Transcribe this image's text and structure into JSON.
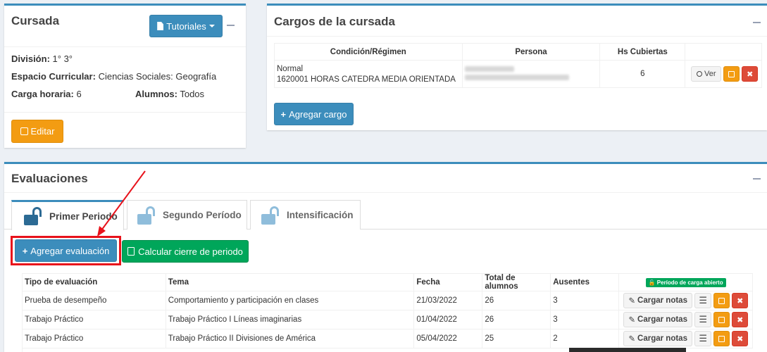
{
  "cursada": {
    "title": "Cursada",
    "tutorials_label": "Tutoriales",
    "division_label": "División:",
    "division_value": "1° 3°",
    "espacio_label": "Espacio Curricular:",
    "espacio_value": "Ciencias Sociales: Geografía",
    "carga_label": "Carga horaria:",
    "carga_value": "6",
    "alumnos_label": "Alumnos:",
    "alumnos_value": "Todos",
    "edit_label": "Editar"
  },
  "cargos": {
    "title": "Cargos de la cursada",
    "headers": [
      "Condición/Régimen",
      "Persona",
      "Hs Cubiertas"
    ],
    "row": {
      "condicion_line1": "Normal",
      "condicion_line2": "1620001 HORAS CATEDRA MEDIA ORIENTADA",
      "hs": "6",
      "ver_label": "Ver"
    },
    "add_label": "Agregar cargo"
  },
  "evaluaciones": {
    "title": "Evaluaciones",
    "tabs": [
      {
        "label": "Primer Periodo"
      },
      {
        "label": "Segundo Período"
      },
      {
        "label": "Intensificación"
      }
    ],
    "add_eval_label": "Agregar evaluación",
    "calc_label": "Calcular cierre de periodo",
    "headers": [
      "Tipo de evaluación",
      "Tema",
      "Fecha",
      "Total de alumnos",
      "Ausentes"
    ],
    "period_badge": "Período de carga abierto",
    "cargar_label": "Cargar notas",
    "rows": [
      {
        "tipo": "Prueba de desempeño",
        "tema": "Comportamiento y participación en clases",
        "fecha": "21/03/2022",
        "total": "26",
        "ausentes": "3"
      },
      {
        "tipo": "Trabajo Práctico",
        "tema": "Trabajo Práctico I Líneas imaginarias",
        "fecha": "01/04/2022",
        "total": "26",
        "ausentes": "3"
      },
      {
        "tipo": "Trabajo Práctico",
        "tema": "Trabajo Práctico II Divisiones de América",
        "fecha": "05/04/2022",
        "total": "25",
        "ausentes": "2"
      }
    ]
  },
  "colors": {
    "primary": "#3c8dbc",
    "warning": "#f39c12",
    "success": "#00a65a",
    "danger": "#dd4b39",
    "annotation": "#e8121b"
  }
}
